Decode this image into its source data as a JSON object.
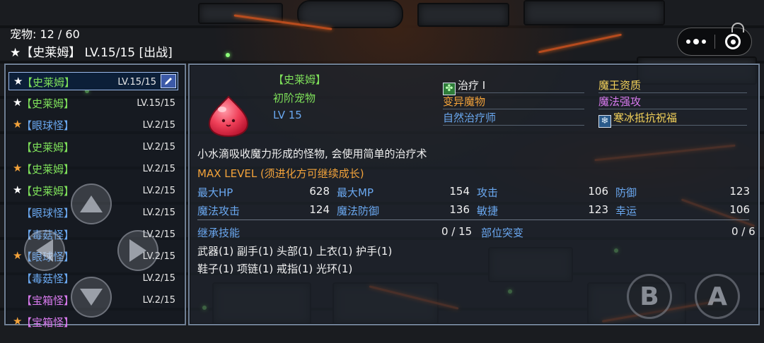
{
  "header": {
    "pet_count": "宠物: 12 / 60",
    "pet_title": "★【史莱姆】 LV.15/15 [出战]"
  },
  "pet_list": [
    {
      "star": "★",
      "star_color": "#ffffff",
      "name": "【史莱姆】",
      "name_color": "#7ee05a",
      "level": "LV.15/15",
      "selected": true
    },
    {
      "star": "★",
      "star_color": "#ffffff",
      "name": "【史莱姆】",
      "name_color": "#7ee05a",
      "level": "LV.15/15"
    },
    {
      "star": "★",
      "star_color": "#f2a23a",
      "name": "【眼球怪】",
      "name_color": "#6aa8f0",
      "level": "LV.2/15"
    },
    {
      "star": "",
      "star_color": "#ffffff",
      "name": "【史莱姆】",
      "name_color": "#7ee05a",
      "level": "LV.2/15"
    },
    {
      "star": "★",
      "star_color": "#f2a23a",
      "name": "【史莱姆】",
      "name_color": "#7ee05a",
      "level": "LV.2/15"
    },
    {
      "star": "★",
      "star_color": "#ffffff",
      "name": "【史莱姆】",
      "name_color": "#7ee05a",
      "level": "LV.2/15"
    },
    {
      "star": "",
      "star_color": "#ffffff",
      "name": "【眼球怪】",
      "name_color": "#6aa8f0",
      "level": "LV.2/15"
    },
    {
      "star": "",
      "star_color": "#ffffff",
      "name": "【毒菇怪】",
      "name_color": "#6aa8f0",
      "level": "LV.2/15"
    },
    {
      "star": "★",
      "star_color": "#f2a23a",
      "name": "【眼球怪】",
      "name_color": "#6aa8f0",
      "level": "LV.2/15"
    },
    {
      "star": "",
      "star_color": "#ffffff",
      "name": "【毒菇怪】",
      "name_color": "#6aa8f0",
      "level": "LV.2/15"
    },
    {
      "star": "",
      "star_color": "#ffffff",
      "name": "【宝箱怪】",
      "name_color": "#d87aee",
      "level": "LV.2/15"
    },
    {
      "star": "★",
      "star_color": "#f2a23a",
      "name": "【宝箱怪】",
      "name_color": "#d87aee",
      "level": ""
    }
  ],
  "detail": {
    "name": "【史莱姆】",
    "rank": "初阶宠物",
    "level": "LV 15",
    "description": "小水滴吸收魔力形成的怪物, 会使用简单的治疗术",
    "max_level": "MAX LEVEL (须进化方可继续成长)",
    "stats": [
      {
        "label": "最大HP",
        "value": "628"
      },
      {
        "label": "最大MP",
        "value": "154"
      },
      {
        "label": "攻击",
        "value": "106"
      },
      {
        "label": "防御",
        "value": "123"
      },
      {
        "label": "魔法攻击",
        "value": "124"
      },
      {
        "label": "魔法防御",
        "value": "136"
      },
      {
        "label": "敏捷",
        "value": "123"
      },
      {
        "label": "幸运",
        "value": "106"
      }
    ],
    "inherit_label": "继承技能",
    "inherit_value": "0 / 15",
    "mutation_label": "部位突变",
    "mutation_value": "0 / 6",
    "equip_line1": "武器(1) 副手(1) 头部(1) 上衣(1) 护手(1)",
    "equip_line2": "鞋子(1) 项链(1) 戒指(1) 光环(1)"
  },
  "skills": {
    "left": [
      {
        "text": "治疗 I",
        "color": "#f0f0f0",
        "icon": "clover-icon"
      },
      {
        "text": "变异魔物",
        "color": "#f2a23a"
      },
      {
        "text": "自然治疗师",
        "color": "#6aa8f0"
      }
    ],
    "right": [
      {
        "text": "魔王资质",
        "color": "#f4d25a"
      },
      {
        "text": "魔法强攻",
        "color": "#d87aee"
      },
      {
        "text": "寒冰抵抗祝福",
        "color": "#f4d25a",
        "icon": "snowflake-icon"
      }
    ]
  },
  "controls": {
    "b_label": "B",
    "a_label": "A"
  }
}
